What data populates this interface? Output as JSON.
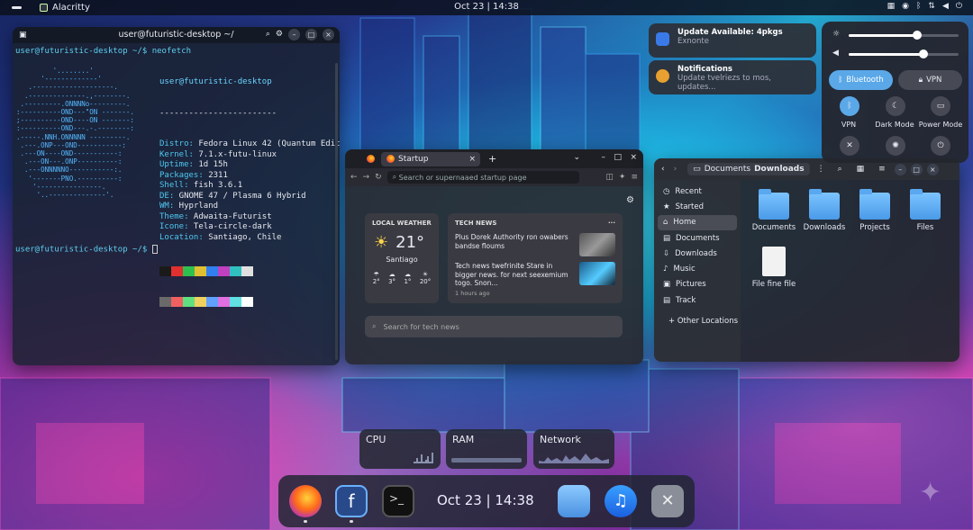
{
  "topbar": {
    "app_name": "Alacritty",
    "clock": "Oct 23 | 14:38"
  },
  "terminal": {
    "title": "user@futuristic-desktop ~/",
    "prompt1": "user@futuristic-desktop ~/$ neofetch",
    "user_host": "user@futuristic-desktop",
    "separator": "------------------------",
    "info": [
      {
        "k": "Distro:",
        "v": " Fedora Linux 42 (Quantum Editi"
      },
      {
        "k": "Kernel:",
        "v": " 7.1.x-futu-linux"
      },
      {
        "k": "Uptime:",
        "v": " 1d 15h"
      },
      {
        "k": "Packages:",
        "v": " 2311"
      },
      {
        "k": "Shell:",
        "v": " fish 3.6.1"
      },
      {
        "k": "DE:",
        "v": " GNOME 47 / Plasma 6 Hybrid"
      },
      {
        "k": "WM:",
        "v": " Hyprland"
      },
      {
        "k": "Theme:",
        "v": " Adwaita-Futurist"
      },
      {
        "k": "Icone:",
        "v": " Tela-circle-dark"
      },
      {
        "k": "Location:",
        "v": " Santiago, Chile"
      }
    ],
    "logo": "         '........'\n      '-------------'\n   .--------------------.\n  .--------------.,--------.\n .---------.ONNNNo---------.\n:----------OND---\"ON -------.\n;----------OND----ON -------:\n:----------OND---.-.--------:\n.-----.NNH.ONNNNN ---------.\n .---.ONP---OND-----------:\n .---ON----OND-----------:\n  .---ON---.ONP----------:\n  .---ONNNNNO-----------:.\n   '-------PNO.----------:\n    '----------------.\n     '..--------------'.",
    "prompt2": "user@futuristic-desktop ~/$",
    "swatch_colors": [
      "#1a1a1a",
      "#e03030",
      "#30c050",
      "#e0c030",
      "#3080f0",
      "#c040c0",
      "#30c0c0",
      "#e0e0e0",
      "#6a6a6a",
      "#f06060",
      "#60e080",
      "#f0d060",
      "#60a0ff",
      "#e070e0",
      "#60e0e0",
      "#ffffff"
    ]
  },
  "browser": {
    "tab_title": "Startup",
    "url_placeholder": "Search or supernaaed startup page",
    "weather": {
      "heading": "LOCAL WEATHER",
      "temp": "21°",
      "city": "Santiago",
      "forecast": [
        "2°",
        "3°",
        "1°",
        "20°"
      ]
    },
    "news": {
      "heading": "TECH NEWS",
      "more": "···",
      "items": [
        "Plus Dorek Authority ron owabers bandse floums",
        "Tech news twefrinite Stare in bigger news. for next seexemium togo. Snon…"
      ],
      "time": "1 hours ago"
    },
    "search_placeholder": "Search for tech news"
  },
  "files": {
    "breadcrumb_parent": "Documents",
    "breadcrumb_current": "Downloads",
    "sidebar": [
      "Recent",
      "Started",
      "Home",
      "Documents",
      "Downloads",
      "Music",
      "Pictures",
      "Track",
      "+ Other Locations"
    ],
    "items": [
      "Documents",
      "Downloads",
      "Projects",
      "Files",
      "File fine file"
    ]
  },
  "notifications": [
    {
      "title": "Update Available: 4pkgs",
      "sub": "Exnonte"
    },
    {
      "title": "Notifications",
      "sub": "Update tvelriezs to mos, updates..."
    }
  ],
  "quick_settings": {
    "bluetooth": "Bluetooth",
    "vpn": "VPN",
    "btn_labels": [
      "VPN",
      "Dark Mode",
      "Power Mode"
    ],
    "brightness": 0.62,
    "volume": 0.68
  },
  "widgets": [
    {
      "label": "CPU"
    },
    {
      "label": "RAM"
    },
    {
      "label": "Network"
    }
  ],
  "dock": {
    "clock": "Oct 23 | 14:38"
  }
}
